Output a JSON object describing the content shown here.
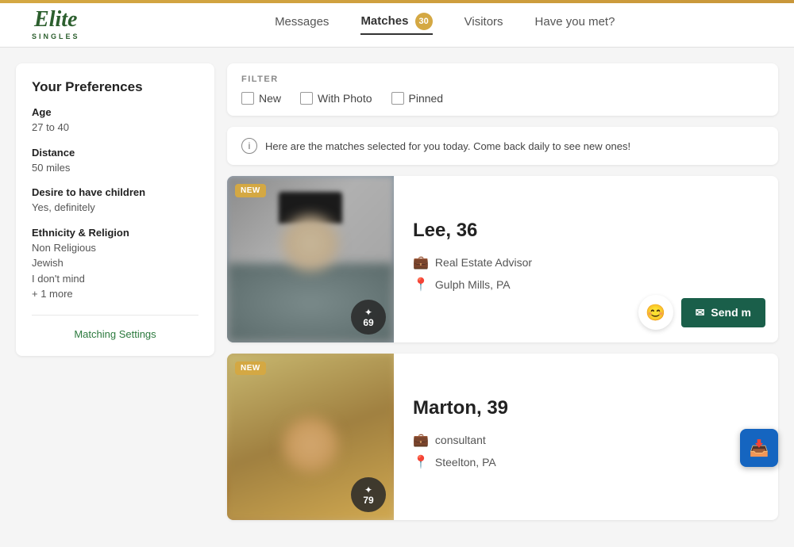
{
  "header": {
    "logo": "Elite",
    "logo_sub": "SINGLES",
    "top_bar_color": "#d4a843",
    "nav": [
      {
        "id": "messages",
        "label": "Messages",
        "active": false,
        "badge": null
      },
      {
        "id": "matches",
        "label": "Matches",
        "active": true,
        "badge": "30"
      },
      {
        "id": "visitors",
        "label": "Visitors",
        "active": false,
        "badge": null
      },
      {
        "id": "have_you_met",
        "label": "Have you met?",
        "active": false,
        "badge": null
      }
    ]
  },
  "sidebar": {
    "title": "Your Preferences",
    "preferences": [
      {
        "id": "age",
        "label": "Age",
        "value": "27 to 40"
      },
      {
        "id": "distance",
        "label": "Distance",
        "value": "50 miles"
      },
      {
        "id": "children",
        "label": "Desire to have children",
        "value": "Yes, definitely"
      },
      {
        "id": "ethnicity",
        "label": "Ethnicity & Religion",
        "value": "Non Religious\nJewish\nI don't mind\n+ 1 more"
      }
    ],
    "matching_settings_link": "Matching Settings"
  },
  "filter": {
    "label": "FILTER",
    "options": [
      {
        "id": "new",
        "label": "New",
        "checked": false
      },
      {
        "id": "with_photo",
        "label": "With Photo",
        "checked": false
      },
      {
        "id": "pinned",
        "label": "Pinned",
        "checked": false
      }
    ]
  },
  "info_banner": {
    "text": "Here are the matches selected for you today. Come back daily to see new ones!"
  },
  "profiles": [
    {
      "id": "lee",
      "name": "Lee",
      "age": "36",
      "display_name": "Lee, 36",
      "is_new": true,
      "score": "69",
      "job": "Real Estate Advisor",
      "location": "Gulph Mills, PA",
      "image_class": "card-img-lee"
    },
    {
      "id": "marton",
      "name": "Marton",
      "age": "39",
      "display_name": "Marton, 39",
      "is_new": true,
      "score": "79",
      "job": "consultant",
      "location": "Steelton, PA",
      "image_class": "card-img-marton"
    }
  ],
  "actions": {
    "smile_label": "😊",
    "send_label": "Send m"
  },
  "labels": {
    "new_badge": "NEW",
    "send_message": "Send m"
  }
}
